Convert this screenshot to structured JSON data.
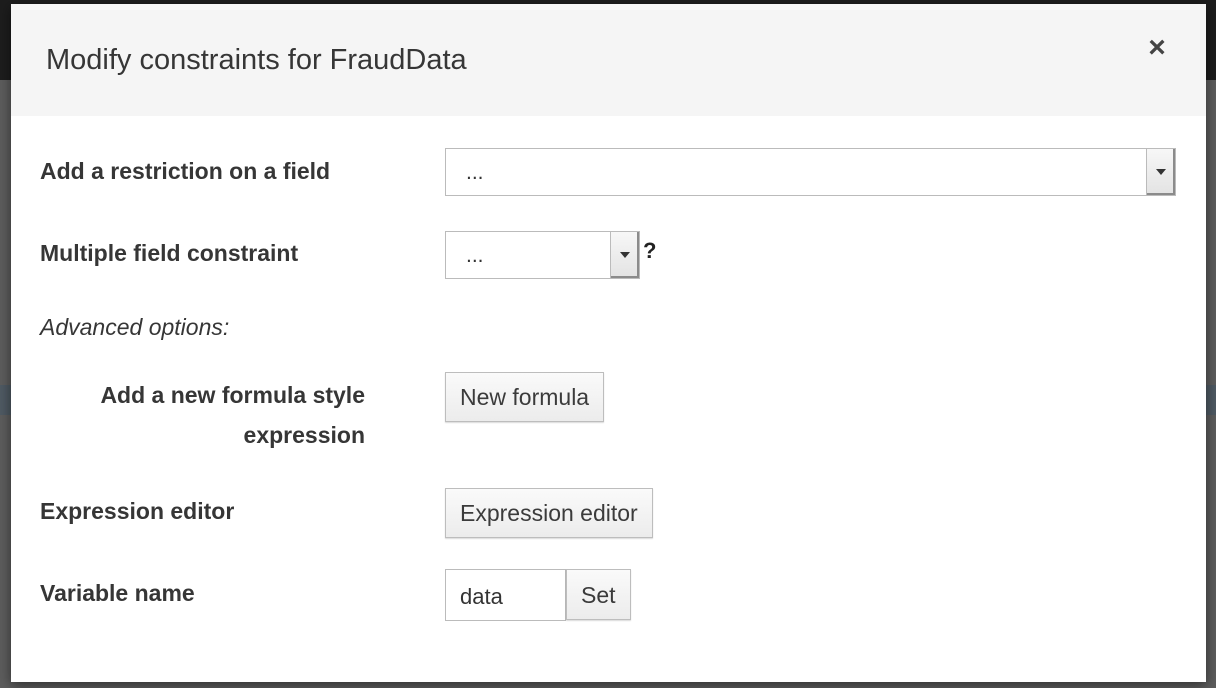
{
  "modal": {
    "title": "Modify constraints for FraudData",
    "close_symbol": "×"
  },
  "restriction": {
    "label": "Add a restriction on a field",
    "selected": "..."
  },
  "multiple": {
    "label": "Multiple field constraint",
    "selected": "...",
    "help": "?"
  },
  "advanced": {
    "label": "Advanced options:"
  },
  "formula": {
    "label_line1": "Add a new formula style",
    "label_line2": "expression",
    "button": "New formula"
  },
  "expression": {
    "label": "Expression editor",
    "button": "Expression editor"
  },
  "variable": {
    "label": "Variable name",
    "value": "data",
    "button": "Set"
  },
  "icons": {
    "close": "close-icon",
    "dropdown": "chevron-down-icon"
  }
}
